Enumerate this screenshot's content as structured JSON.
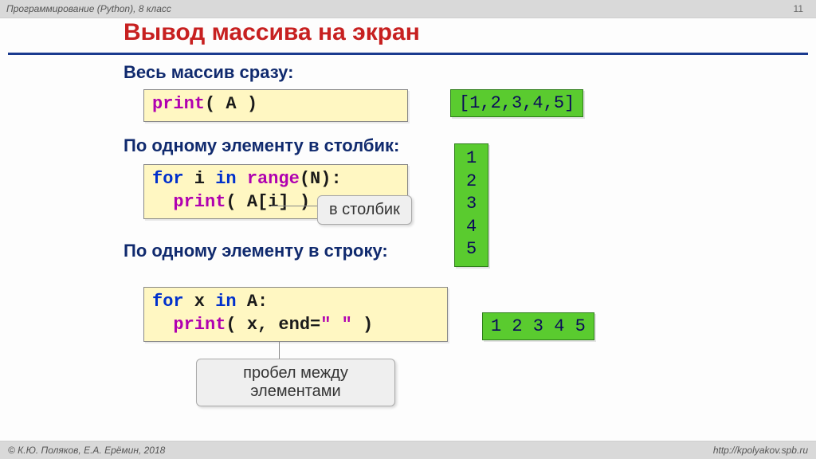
{
  "header": {
    "left": "Программирование (Python), 8 класс",
    "page": "11"
  },
  "footer": {
    "left": "© К.Ю. Поляков, Е.А. Ерёмин, 2018",
    "right": "http://kpolyakov.spb.ru"
  },
  "title": "Вывод массива на экран",
  "sections": {
    "s1": {
      "heading": "Весь массив сразу:",
      "code_print": "print",
      "code_rest": "( A )",
      "output": "[1,2,3,4,5]"
    },
    "s2": {
      "heading": "По одному элементу в столбик:",
      "l1_for": "for",
      "l1_i": " i ",
      "l1_in": "in",
      "l1_range": " range",
      "l1_rest": "(N):",
      "l2_indent": "  ",
      "l2_print": "print",
      "l2_rest": "( A[i] )",
      "callout": "в столбик",
      "output": "1\n2\n3\n4\n5"
    },
    "s3": {
      "heading": "По одному элементу в строку:",
      "l1_for": "for",
      "l1_x": " x ",
      "l1_in": "in",
      "l1_rest": " A:",
      "l2_indent": "  ",
      "l2_print": "print",
      "l2_mid": "( x, end=",
      "l2_str": "\" \"",
      "l2_end": " )",
      "callout": "пробел между\nэлементами",
      "output": "1 2 3 4 5"
    }
  }
}
